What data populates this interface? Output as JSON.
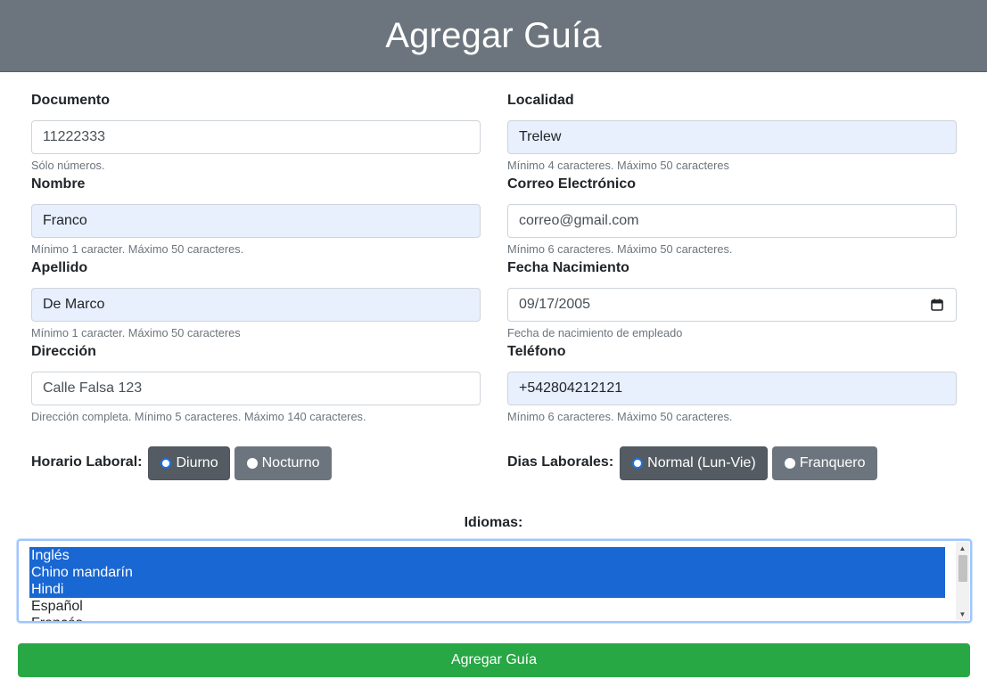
{
  "header": {
    "title": "Agregar Guía"
  },
  "fields": {
    "documento": {
      "label": "Documento",
      "value": "11222333",
      "help": "Sólo números."
    },
    "localidad": {
      "label": "Localidad",
      "value": "Trelew",
      "help": "Mínimo 4 caracteres. Máximo 50 caracteres"
    },
    "nombre": {
      "label": "Nombre",
      "value": "Franco",
      "help": "Mínimo 1 caracter. Máximo 50 caracteres."
    },
    "correo": {
      "label": "Correo Electrónico",
      "value": "correo@gmail.com",
      "help": "Mínimo 6 caracteres. Máximo 50 caracteres."
    },
    "apellido": {
      "label": "Apellido",
      "value": "De Marco",
      "help": "Mínimo 1 caracter. Máximo 50 caracteres"
    },
    "fecha": {
      "label": "Fecha Nacimiento",
      "value": "09/17/2005",
      "help": "Fecha de nacimiento de empleado",
      "icon": "calendar-icon"
    },
    "direccion": {
      "label": "Dirección",
      "value": "Calle Falsa 123",
      "help": "Dirección completa. Mínimo 5 caracteres. Máximo 140 caracteres."
    },
    "telefono": {
      "label": "Teléfono",
      "value": "+542804212121",
      "help": "Mínimo 6 caracteres. Máximo 50 caracteres."
    }
  },
  "horario": {
    "label": "Horario Laboral:",
    "options": [
      {
        "label": "Diurno",
        "checked": true
      },
      {
        "label": "Nocturno",
        "checked": false
      }
    ]
  },
  "dias": {
    "label": "Dias Laborales:",
    "options": [
      {
        "label": "Normal (Lun-Vie)",
        "checked": true
      },
      {
        "label": "Franquero",
        "checked": false
      }
    ]
  },
  "idiomas": {
    "label": "Idiomas:",
    "options": [
      {
        "label": "Inglés",
        "selected": true
      },
      {
        "label": "Chino mandarín",
        "selected": true
      },
      {
        "label": "Hindi",
        "selected": true
      },
      {
        "label": "Español",
        "selected": false
      },
      {
        "label": "Francés",
        "selected": false
      }
    ]
  },
  "submit": {
    "label": "Agregar Guía"
  },
  "colors": {
    "header_bg": "#6c757d",
    "autofill_bg": "#e8f0fe",
    "selected_option_bg": "#1967d2",
    "submit_bg": "#28a745",
    "radio_active_bg": "#545b62"
  }
}
